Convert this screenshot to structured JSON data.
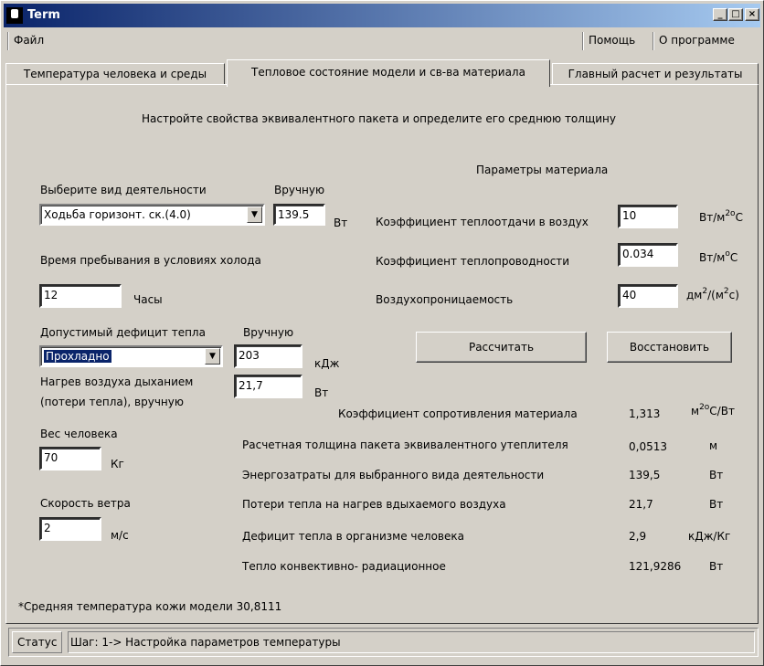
{
  "window": {
    "title": "Term",
    "minimize": "_",
    "maximize": "□",
    "close": "×"
  },
  "menu": {
    "file": "Файл",
    "help": "Помощь",
    "about": "О программе"
  },
  "tabs": [
    "Температура человека и среды",
    "Тепловое состояние модели и св-ва материала",
    "Главный расчет и результаты"
  ],
  "header": "Настройте свойства эквивалентного пакета и определите его среднюю толщину",
  "activity": {
    "label": "Выберите вид деятельности",
    "manual_label": "Вручную",
    "selected": "Ходьба горизонт. ск.(4.0)",
    "manual_value": "139.5",
    "unit": "Вт"
  },
  "cold_time": {
    "label": "Время пребывания в условиях холода",
    "value": "12",
    "unit": "Часы"
  },
  "heat_deficit": {
    "label": "Допустимый дефицит тепла",
    "manual_label": "Вручную",
    "selected": "Прохладно",
    "value": "203",
    "unit": "кДж"
  },
  "breath": {
    "label1": "Нагрев воздуха дыханием",
    "label2": "(потери тепла),  вручную",
    "value": "21,7",
    "unit": "Вт"
  },
  "weight": {
    "label": "Вес человека",
    "value": "70",
    "unit": "Кг"
  },
  "wind": {
    "label": "Скорость ветра",
    "value": "2",
    "unit": "м/с"
  },
  "material": {
    "title": "Параметры материала",
    "heat_transfer": {
      "label": "Коэффициент теплоотдачи в воздух",
      "value": "10",
      "unit": "Вт/м",
      "sup": "2о",
      "unit_end": "С"
    },
    "conductivity": {
      "label": "Коэффициент теплопроводности",
      "value": "0.034",
      "unit": "Вт/м",
      "sup": "о",
      "unit_end": "С"
    },
    "permeability": {
      "label": "Воздухопроницаемость",
      "value": "40",
      "unit": "дм",
      "sup": "2",
      "unit_mid": "/(м",
      "sup2": "2",
      "unit_end": "с)"
    }
  },
  "buttons": {
    "calc": "Рассчитать",
    "restore": "Восстановить"
  },
  "results": [
    {
      "label": "Коэффициент сопротивления материала",
      "value": "1,313",
      "unit": "м",
      "sup": "2о",
      "unit_end": "С/Вт"
    },
    {
      "label": "Расчетная толщина пакета эквивалентного утеплителя",
      "value": "0,0513",
      "unit": "м"
    },
    {
      "label": "Энергозатраты для выбранного вида деятельности",
      "value": "139,5",
      "unit": "Вт"
    },
    {
      "label": "Потери тепла на нагрев вдыхаемого воздуха",
      "value": "21,7",
      "unit": "Вт"
    },
    {
      "label": "Дефицит тепла в организме человека",
      "value": "2,9",
      "unit": "кДж/Кг"
    },
    {
      "label": "Тепло конвективно- радиационное",
      "value": "121,9286",
      "unit": "Вт"
    }
  ],
  "skin_temp": "*Средняя температура кожи модели  30,8111",
  "status": {
    "label": "Статус",
    "message": "Шаг: 1-> Настройка параметров температуры"
  },
  "colors": {
    "title_start": "#0a246a",
    "title_end": "#a6caf0",
    "face": "#d4d0c8",
    "selection": "#0a246a"
  }
}
